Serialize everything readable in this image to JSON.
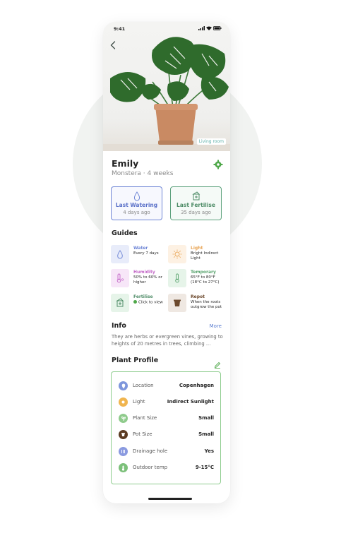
{
  "status_bar": {
    "time": "9:41"
  },
  "header": {
    "room_tag": "Living room"
  },
  "plant": {
    "name": "Emily",
    "subtitle": "Monstera · 4 weeks"
  },
  "cards": {
    "watering": {
      "title": "Last Watering",
      "detail": "4 days ago"
    },
    "fertilise": {
      "title": "Last Fertilise",
      "detail": "35 days ago"
    }
  },
  "guides": {
    "title": "Guides",
    "items": [
      {
        "title": "Water",
        "value": "Every 7 days",
        "color": "#6f86d6",
        "bg": "#e8ecfa",
        "icon": "drop-icon"
      },
      {
        "title": "Light",
        "value": "Bright Indirect Light",
        "color": "#e9a555",
        "bg": "#fdf1e3",
        "icon": "sun-icon"
      },
      {
        "title": "Humidity",
        "value": "50% to 60% or higher",
        "color": "#c367c7",
        "bg": "#f7e6f8",
        "icon": "thermometer-icon"
      },
      {
        "title": "Temporary",
        "value": "65°F to 80°F (18°C to 27°C)",
        "color": "#5aa46f",
        "bg": "#e6f4e9",
        "icon": "thermometer-icon"
      },
      {
        "title": "Fertilise",
        "value": "Click to view",
        "color": "#4e8c67",
        "bg": "#e6f4e9",
        "icon": "fertiliser-icon"
      },
      {
        "title": "Repot",
        "value": "When the roots outgrow the pot",
        "color": "#6d4a2e",
        "bg": "#efe8e2",
        "icon": "pot-icon"
      }
    ]
  },
  "info": {
    "title": "Info",
    "more": "More",
    "text": "They are herbs or evergreen vines, growing to heights of 20 metres in trees, climbing ..."
  },
  "profile": {
    "title": "Plant Profile",
    "rows": [
      {
        "label": "Location",
        "value": "Copenhagen",
        "color": "#7e96dc",
        "icon": "location-pin-icon"
      },
      {
        "label": "Light",
        "value": "Indirect Sunlight",
        "color": "#f0b54f",
        "icon": "sun-icon"
      },
      {
        "label": "Plant Size",
        "value": "Small",
        "color": "#8fcb8c",
        "icon": "sprout-icon"
      },
      {
        "label": "Pot Size",
        "value": "Small",
        "color": "#5b3b22",
        "icon": "pot-icon"
      },
      {
        "label": "Drainage hole",
        "value": "Yes",
        "color": "#8a9ae0",
        "icon": "drainage-icon"
      },
      {
        "label": "Outdoor temp",
        "value": "9-15°C",
        "color": "#7cc07a",
        "icon": "thermometer-icon"
      }
    ]
  }
}
